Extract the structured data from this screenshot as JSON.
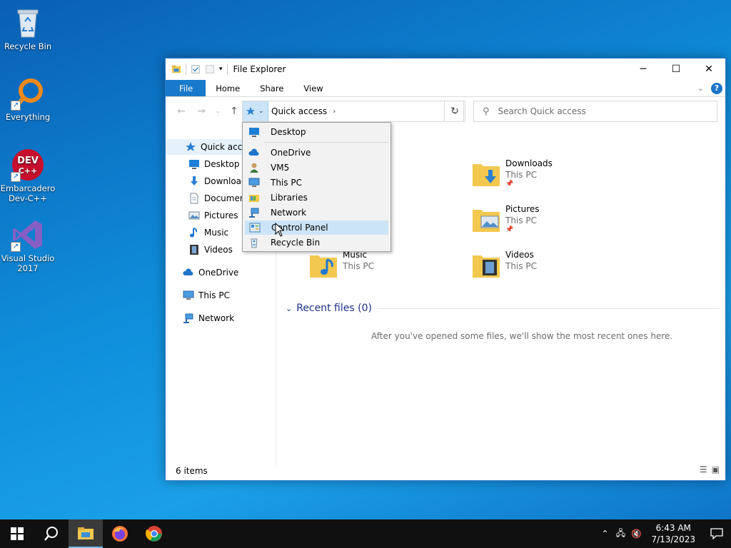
{
  "desktop": {
    "icons": [
      {
        "label": "Recycle Bin",
        "icon": "recycle-bin-icon"
      },
      {
        "label": "Everything",
        "icon": "everything-icon"
      },
      {
        "label": "Embarcadero Dev-C++",
        "icon": "devcpp-icon"
      },
      {
        "label": "Visual Studio 2017",
        "icon": "visual-studio-icon"
      }
    ]
  },
  "window": {
    "title": "File Explorer",
    "ribbon_tabs": [
      "File",
      "Home",
      "Share",
      "View"
    ],
    "help_label": "?",
    "address": {
      "crumb": "Quick access"
    },
    "search_placeholder": "Search Quick access",
    "status": "6 items"
  },
  "navpane": {
    "items": [
      {
        "label": "Quick access",
        "icon": "star-icon"
      },
      {
        "label": "Desktop",
        "icon": "desktop-icon"
      },
      {
        "label": "Downloads",
        "icon": "downloads-icon"
      },
      {
        "label": "Documents",
        "icon": "documents-icon"
      },
      {
        "label": "Pictures",
        "icon": "pictures-icon"
      },
      {
        "label": "Music",
        "icon": "music-icon"
      },
      {
        "label": "Videos",
        "icon": "videos-icon"
      },
      {
        "label": "OneDrive",
        "icon": "cloud-icon"
      },
      {
        "label": "This PC",
        "icon": "pc-icon"
      },
      {
        "label": "Network",
        "icon": "network-icon"
      }
    ]
  },
  "content": {
    "tiles": [
      {
        "name": "Downloads",
        "location": "This PC",
        "pinned": true
      },
      {
        "name": "Pictures",
        "location": "This PC",
        "pinned": true
      },
      {
        "name": "Music",
        "location": "This PC",
        "pinned": false
      },
      {
        "name": "Videos",
        "location": "This PC",
        "pinned": false
      }
    ],
    "recent_header": "Recent files (0)",
    "recent_empty": "After you've opened some files, we'll show the most recent ones here."
  },
  "dropdown": {
    "items": [
      {
        "label": "Desktop",
        "icon": "desktop-icon"
      },
      {
        "label": "OneDrive",
        "icon": "cloud-icon"
      },
      {
        "label": "VM5",
        "icon": "user-icon"
      },
      {
        "label": "This PC",
        "icon": "pc-icon"
      },
      {
        "label": "Libraries",
        "icon": "libraries-icon"
      },
      {
        "label": "Network",
        "icon": "network-icon"
      },
      {
        "label": "Control Panel",
        "icon": "control-panel-icon"
      },
      {
        "label": "Recycle Bin",
        "icon": "recycle-bin-icon"
      }
    ],
    "hovered": "Control Panel"
  },
  "taskbar": {
    "time": "6:43 AM",
    "date": "7/13/2023"
  },
  "colors": {
    "accent": "#1979ca",
    "hover": "#cce4f7",
    "taskbar": "#101010"
  }
}
